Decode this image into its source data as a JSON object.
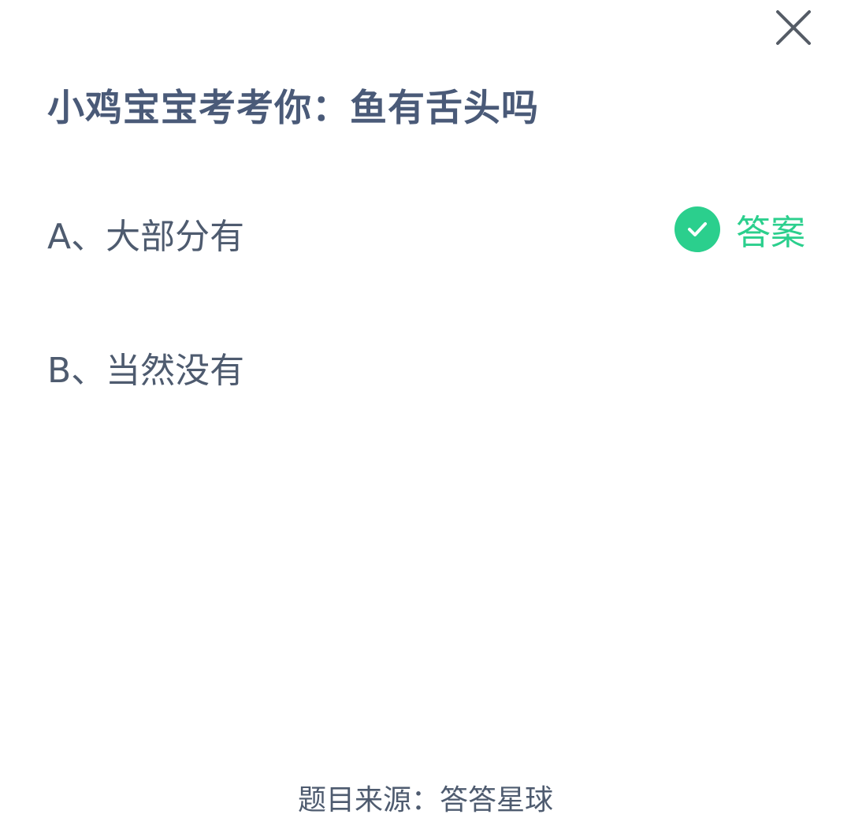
{
  "dialog": {
    "close_icon": "close-icon"
  },
  "question": {
    "title": "小鸡宝宝考考你：鱼有舌头吗"
  },
  "options": [
    {
      "text": "A、大部分有",
      "is_answer": true
    },
    {
      "text": "B、当然没有",
      "is_answer": false
    }
  ],
  "answer_tag": {
    "label": "答案",
    "icon": "check-circle-icon",
    "color": "#2bcf8d"
  },
  "footer": {
    "source": "题目来源：答答星球"
  },
  "colors": {
    "title": "#4a5a78",
    "text": "#4e5b6f",
    "accent": "#2bcf8d",
    "background": "#ffffff"
  }
}
